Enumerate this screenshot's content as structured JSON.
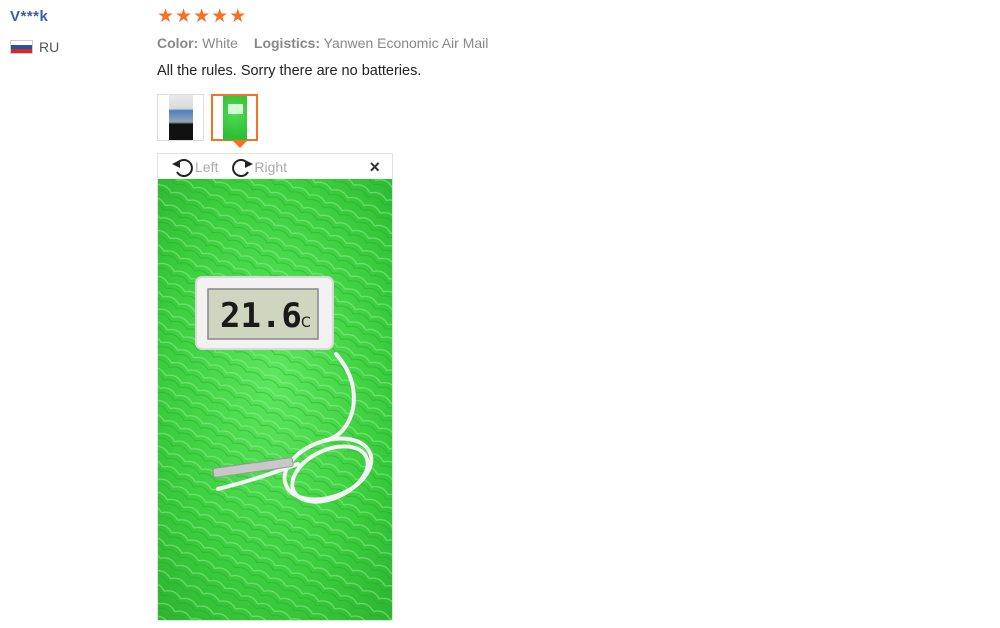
{
  "user": {
    "name": "V***k",
    "country": "RU",
    "flag_colors": [
      "#ffffff",
      "#2b4fa8",
      "#d52b1e"
    ]
  },
  "review": {
    "rating": 5,
    "star_char": "★",
    "color_label": "Color:",
    "color_value": "White",
    "logistics_label": "Logistics:",
    "logistics_value": "Yanwen Economic Air Mail",
    "comment": "All the rules. Sorry there are no batteries."
  },
  "viewer": {
    "rotate_left_label": "Left",
    "rotate_right_label": "Right",
    "close_symbol": "×",
    "display_reading": "21.6",
    "display_unit": "°C"
  },
  "colors": {
    "accent": "#f57224",
    "username": "#3a5ea8",
    "photo_green": "#3ccf3f"
  }
}
